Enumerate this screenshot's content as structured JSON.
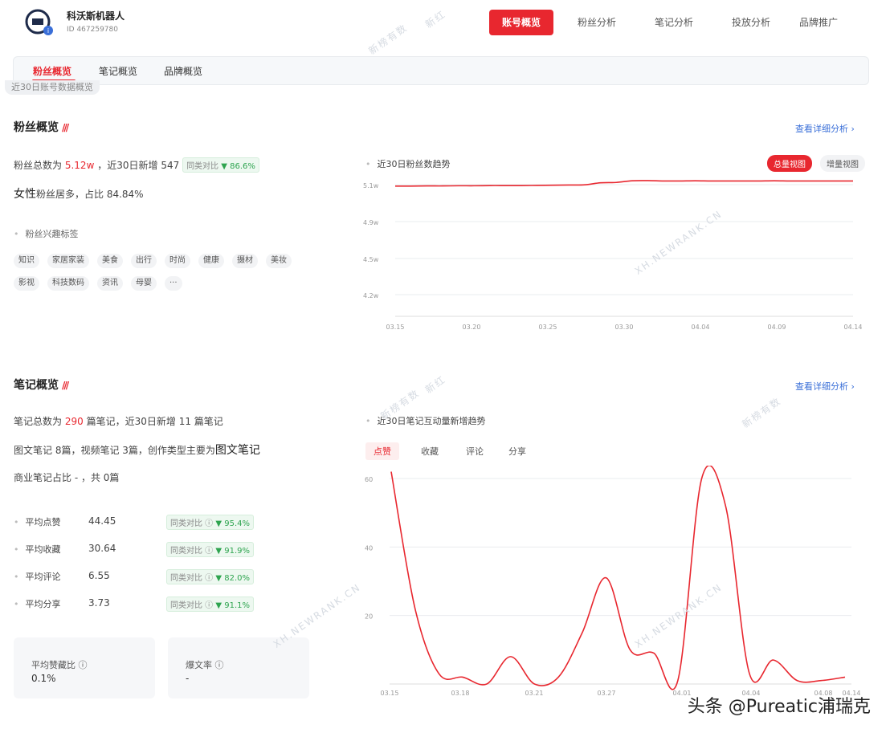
{
  "header": {
    "account_name": "科沃斯机器人",
    "account_id": "ID 467259780",
    "nav": [
      "账号概览",
      "粉丝分析",
      "笔记分析",
      "投放分析",
      "品牌推广"
    ],
    "active_nav": "账号概览"
  },
  "subnav": {
    "tabs": [
      "粉丝概览",
      "笔记概览",
      "品牌概览"
    ],
    "hint": "近30日账号数据概览"
  },
  "fans": {
    "title": "粉丝概览",
    "detail_link": "查看详细分析 ›",
    "total_label": "粉丝总数为",
    "total_value": "5.12w",
    "new_label": "，近30日新增",
    "new_value": "547",
    "compare_label": "同类对比",
    "compare_value": "▼ 86.6%",
    "gender_prefix": "女性",
    "gender_text": "粉丝居多，占比 84.84%",
    "interest_label": "粉丝兴趣标签",
    "tags": [
      "知识",
      "家居家装",
      "美食",
      "出行",
      "时尚",
      "健康",
      "摄材",
      "美妆",
      "影视",
      "科技数码",
      "资讯",
      "母婴",
      "···"
    ]
  },
  "fans_chart": {
    "title": "近30日粉丝数趋势",
    "btn_total": "总量视图",
    "btn_increment": "增量视图"
  },
  "notes": {
    "title": "笔记概览",
    "detail_link": "查看详细分析 ›",
    "line1_prefix": "笔记总数为",
    "line1_total": "290",
    "line1_mid": "篇笔记，近30日新增",
    "line1_new": "11",
    "line1_suffix": "篇笔记",
    "line2": "图文笔记 8篇，视频笔记 3篇，创作类型主要为",
    "line2_type": "图文笔记",
    "line3": "商业笔记占比 - ，共 0篇",
    "stats": [
      {
        "label": "平均点赞",
        "value": "44.45",
        "compare": "同类对比",
        "pct": "▼ 95.4%"
      },
      {
        "label": "平均收藏",
        "value": "30.64",
        "compare": "同类对比",
        "pct": "▼ 91.9%"
      },
      {
        "label": "平均评论",
        "value": "6.55",
        "compare": "同类对比",
        "pct": "▼ 82.0%"
      },
      {
        "label": "平均分享",
        "value": "3.73",
        "compare": "同类对比",
        "pct": "▼ 91.1%"
      }
    ],
    "cards": [
      {
        "label": "平均赞藏比",
        "value": "0.1%"
      },
      {
        "label": "爆文率",
        "value": "-"
      }
    ]
  },
  "notes_chart": {
    "title": "近30日笔记互动量新增趋势",
    "tabs": [
      "点赞",
      "收藏",
      "评论",
      "分享"
    ]
  },
  "watermarks": {
    "a": "新榜有数",
    "b": "新红",
    "c": "XH.NEWRANK.CN"
  },
  "footer": {
    "credit": "头条 @Pureatic浦瑞克"
  },
  "chart_data": [
    {
      "type": "line",
      "title": "近30日粉丝数趋势",
      "x": [
        "03.15",
        "03.20",
        "03.25",
        "03.30",
        "04.04",
        "04.09",
        "04.14"
      ],
      "yticks": [
        "5.1w",
        "4.9w",
        "4.5w",
        "4.2w"
      ],
      "ylim": [
        4.1,
        5.15
      ],
      "series": [
        {
          "values": [
            5.092,
            5.092,
            5.093,
            5.093,
            5.094,
            5.094,
            5.095,
            5.095,
            5.095,
            5.096,
            5.097,
            5.098,
            5.099,
            5.11,
            5.112,
            5.121,
            5.122,
            5.12,
            5.12,
            5.121,
            5.12,
            5.12,
            5.12,
            5.12,
            5.121,
            5.12,
            5.12,
            5.12,
            5.12,
            5.12
          ]
        }
      ],
      "color": "#e8272f"
    },
    {
      "type": "line",
      "title": "近30日笔记互动量新增趋势",
      "x": [
        "03.15",
        "03.18",
        "03.21",
        "03.27",
        "04.01",
        "04.04",
        "04.08",
        "04.14"
      ],
      "yticks": [
        60,
        40,
        20
      ],
      "ylim": [
        0,
        62
      ],
      "series": [
        {
          "name": "点赞",
          "values": [
            62,
            22,
            3,
            2,
            0,
            8,
            0,
            2,
            15,
            31,
            10,
            9,
            1,
            60,
            52,
            3,
            7,
            1,
            1,
            2
          ]
        }
      ],
      "color": "#e8272f"
    }
  ]
}
